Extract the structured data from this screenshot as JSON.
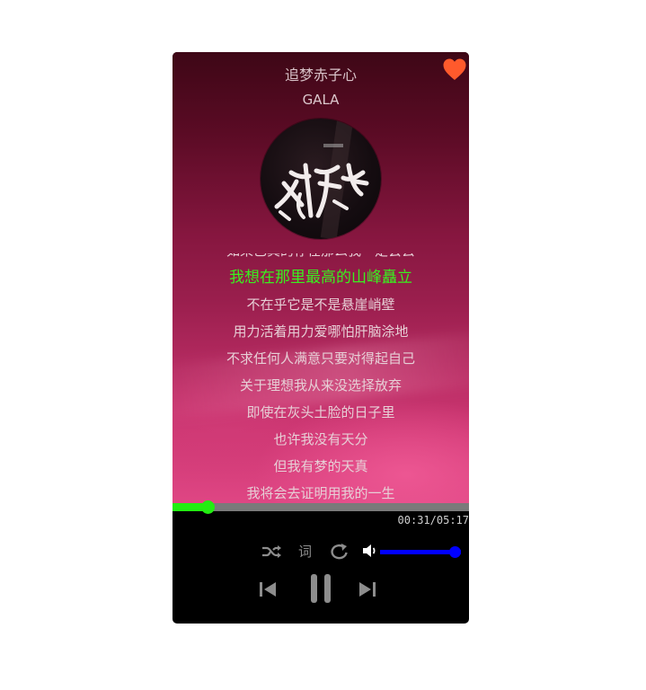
{
  "song": {
    "title": "追梦赤子心",
    "artist": "GALA",
    "favorited": true
  },
  "lyrics": {
    "current_index": 1,
    "lines": [
      "如果已真的存在那么我一定会去",
      "我想在那里最高的山峰矗立",
      "不在乎它是不是悬崖峭壁",
      "用力活着用力爱哪怕肝脑涂地",
      "不求任何人满意只要对得起自己",
      "关于理想我从来没选择放弃",
      "即使在灰头土脸的日子里",
      "也许我没有天分",
      "但我有梦的天真",
      "我将会去证明用我的一生"
    ]
  },
  "playback": {
    "current_time": "00:31",
    "separator": "/",
    "total_time": "05:17",
    "progress": 0.118,
    "volume": 1.0,
    "state": "playing"
  },
  "controls": {
    "lyric_toggle_label": "词",
    "icons": [
      "heart-icon",
      "shuffle-icon",
      "repeat-icon",
      "volume-icon",
      "previous-icon",
      "pause-icon",
      "next-icon"
    ]
  },
  "colors": {
    "progress": "#22ee11",
    "volume": "#0000ff",
    "current_lyric": "#39f01f",
    "heart": "#ff5a2c"
  }
}
